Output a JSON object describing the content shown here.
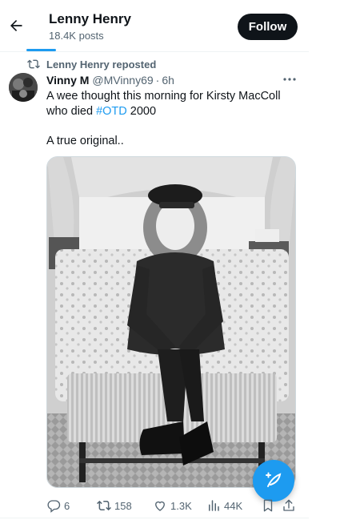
{
  "header": {
    "name": "Lenny Henry",
    "post_count": "18.4K posts",
    "follow_label": "Follow"
  },
  "repost": {
    "label": "Lenny Henry reposted"
  },
  "tweet": {
    "author_name": "Vinny M",
    "author_handle": "@MVinny69",
    "separator": "·",
    "time": "6h",
    "text_line1_pre": "A wee thought this morning for Kirsty MacColl who died ",
    "hashtag": "#OTD",
    "text_line1_post": " 2000",
    "text_line2": "A true original.."
  },
  "actions": {
    "replies": "6",
    "reposts": "158",
    "likes": "1.3K",
    "views": "44K"
  },
  "colors": {
    "accent": "#1d9bf0",
    "text": "#0f1419",
    "muted": "#536471"
  }
}
